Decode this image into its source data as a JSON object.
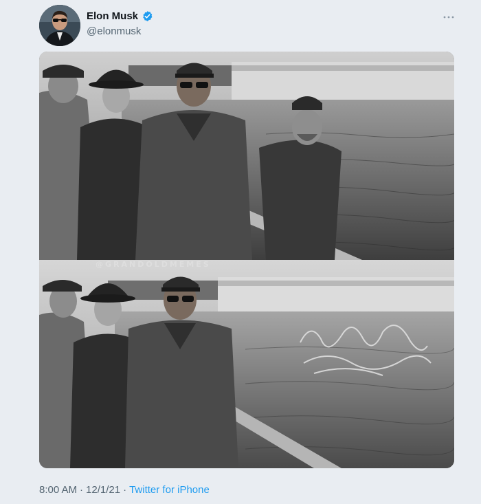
{
  "author": {
    "display_name": "Elon Musk",
    "handle": "@elonmusk",
    "verified": true
  },
  "media": {
    "watermark": "@GRANDOLDMEMES"
  },
  "meta": {
    "time": "8:00 AM",
    "separator1": "·",
    "date": "12/1/21",
    "separator2": "·",
    "source": "Twitter for iPhone"
  },
  "colors": {
    "background": "#e9edf2",
    "name": "#0f1419",
    "secondary": "#536471",
    "link": "#1d9bf0",
    "verified": "#1d9bf0"
  },
  "icons": {
    "verified": "verified-badge-icon",
    "more": "more-options-icon"
  }
}
